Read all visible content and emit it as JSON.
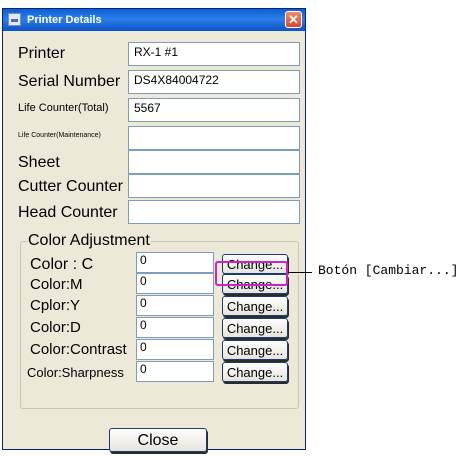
{
  "window": {
    "title": "Printer Details",
    "close_glyph": "✕"
  },
  "fields": [
    {
      "label": "Printer",
      "value": "RX-1 #1"
    },
    {
      "label": "Serial Number",
      "value": "DS4X84004722"
    },
    {
      "label": "Life Counter(Total)",
      "value": "5567"
    },
    {
      "label": "Life Counter(Maintenance)",
      "value": ""
    },
    {
      "label": "Sheet",
      "value": ""
    },
    {
      "label": "Cutter Counter",
      "value": ""
    },
    {
      "label": "Head Counter",
      "value": ""
    }
  ],
  "color_adjustment": {
    "title": "Color Adjustment",
    "rows": [
      {
        "label": "Color : C",
        "value": "0",
        "button": "Change..."
      },
      {
        "label": "Color:M",
        "value": "0",
        "button": "Change..."
      },
      {
        "label": "Cplor:Y",
        "value": "0",
        "button": "Change..."
      },
      {
        "label": "Color:D",
        "value": "0",
        "button": "Change..."
      },
      {
        "label": "Color:Contrast",
        "value": "0",
        "button": "Change..."
      },
      {
        "label": "Color:Sharpness",
        "value": "0",
        "button": "Change..."
      }
    ]
  },
  "close_button": "Close",
  "callout": {
    "text": "Botón [Cambiar...]",
    "color": "#cc22cc"
  }
}
